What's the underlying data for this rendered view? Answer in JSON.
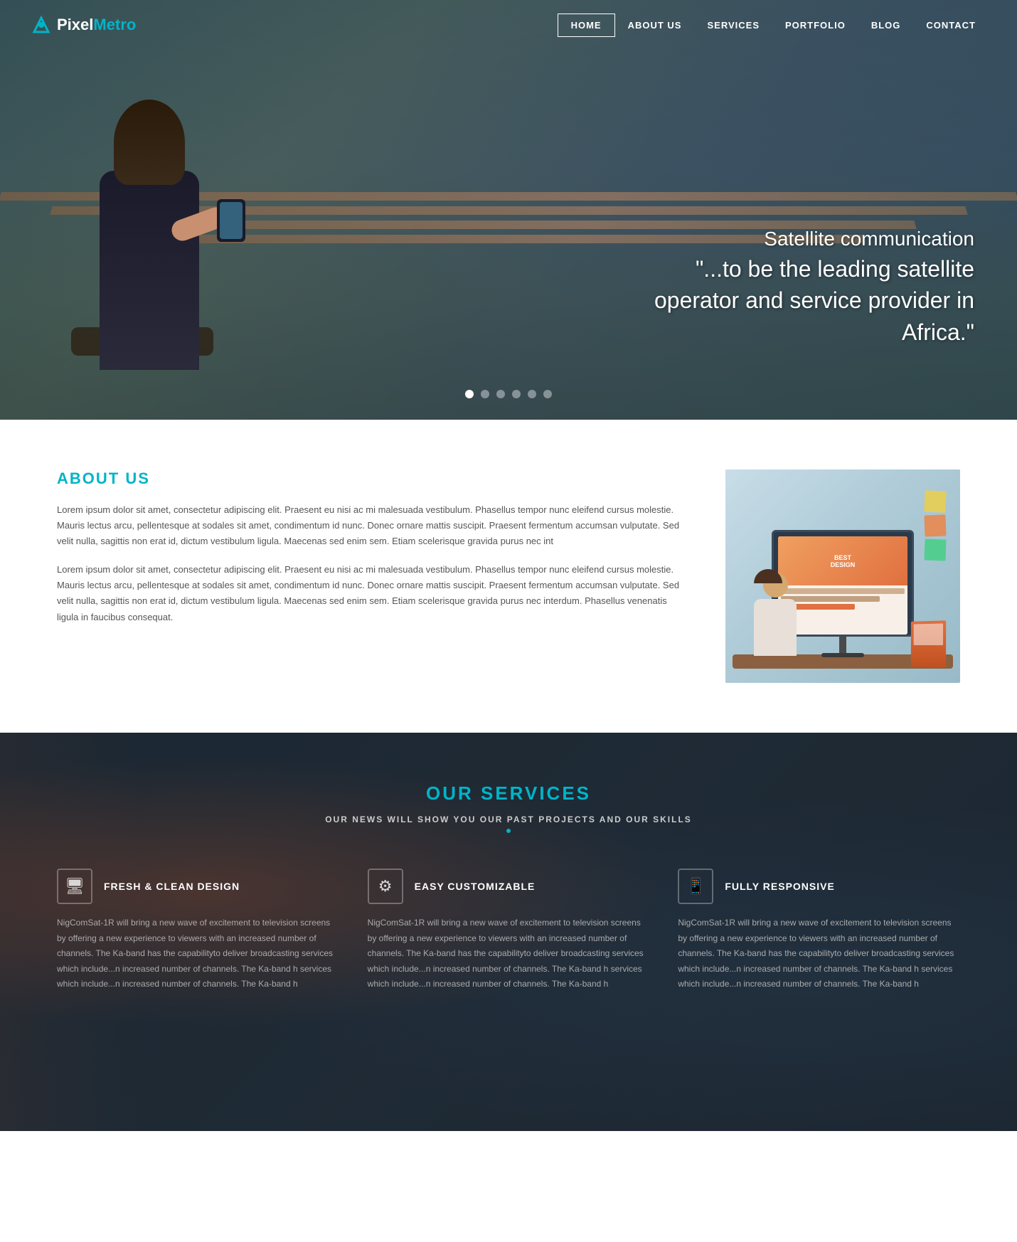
{
  "logo": {
    "icon_symbol": "⚡",
    "text_pixel": "Pixel",
    "text_metro": "Metro"
  },
  "nav": {
    "items": [
      {
        "label": "HOME",
        "active": true,
        "id": "home"
      },
      {
        "label": "ABOUT US",
        "active": false,
        "id": "about"
      },
      {
        "label": "SERVICES",
        "active": false,
        "id": "services"
      },
      {
        "label": "PORTFOLIO",
        "active": false,
        "id": "portfolio"
      },
      {
        "label": "BLOG",
        "active": false,
        "id": "blog"
      },
      {
        "label": "CONTACT",
        "active": false,
        "id": "contact"
      }
    ]
  },
  "hero": {
    "text_line1": "Satellite communication",
    "text_line2": "\"...to be the leading satellite",
    "text_line3": "operator and service provider in Africa.\"",
    "dots_count": 6,
    "active_dot": 0
  },
  "about": {
    "heading": "ABOUT US",
    "paragraph1": "Lorem ipsum dolor sit amet, consectetur adipiscing elit. Praesent eu nisi ac mi malesuada vestibulum. Phasellus tempor nunc eleifend cursus molestie. Mauris lectus arcu, pellentesque at sodales sit amet, condimentum id nunc. Donec ornare mattis suscipit. Praesent fermentum accumsan vulputate. Sed velit nulla, sagittis non erat id, dictum vestibulum ligula. Maecenas sed enim sem. Etiam scelerisque gravida purus nec int",
    "paragraph2": "Lorem ipsum dolor sit amet, consectetur adipiscing elit. Praesent eu nisi ac mi malesuada vestibulum. Phasellus tempor nunc eleifend cursus molestie. Mauris lectus arcu, pellentesque at sodales sit amet, condimentum id nunc. Donec ornare mattis suscipit. Praesent fermentum accumsan vulputate. Sed velit nulla, sagittis non erat id, dictum vestibulum ligula. Maecenas sed enim sem. Etiam scelerisque gravida purus nec interdum. Phasellus venenatis ligula in faucibus consequat."
  },
  "services": {
    "heading": "OUR SERVICES",
    "subtitle": "OUR NEWS WILL SHOW YOU OUR PAST PROJECTS AND OUR SKILLS",
    "items": [
      {
        "icon": "🖥",
        "title": "FRESH & CLEAN DESIGN",
        "description": "NigComSat-1R will bring a new wave of excitement to television screens by offering a new experience to viewers with an increased number of channels. The Ka-band has the capabilityto deliver broadcasting services which include...n increased number of channels. The Ka-band h services which include...n increased number of channels. The Ka-band h"
      },
      {
        "icon": "⚙",
        "title": "EASY CUSTOMIZABLE",
        "description": "NigComSat-1R will bring a new wave of excitement to television screens by offering a new experience to viewers with an increased number of channels. The Ka-band has the capabilityto deliver broadcasting services which include...n increased number of channels. The Ka-band h services which include...n increased number of channels. The Ka-band h"
      },
      {
        "icon": "📱",
        "title": "FULLY RESPONSIVE",
        "description": "NigComSat-1R will bring a new wave of excitement to television screens by offering a new experience to viewers with an increased number of channels. The Ka-band has the capabilityto deliver broadcasting services which include...n increased number of channels. The Ka-band h services which include...n increased number of channels. The Ka-band h"
      }
    ]
  },
  "colors": {
    "accent": "#00b4c8",
    "dark_bg": "rgba(20,30,40,0.85)",
    "text_light": "#ffffff",
    "text_muted": "#aaaaaa"
  }
}
